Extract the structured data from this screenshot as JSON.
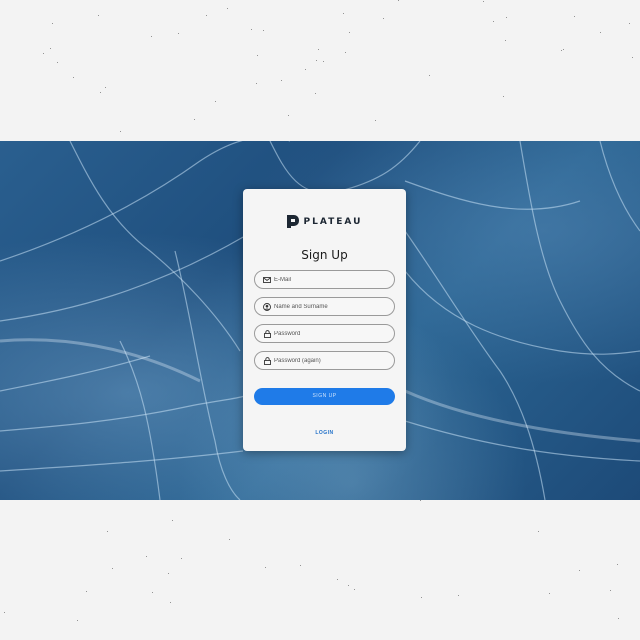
{
  "brand": {
    "name": "PLATEAU",
    "icon": "plateau-logo-icon",
    "color": "#1d2733"
  },
  "form": {
    "title": "Sign Up",
    "fields": [
      {
        "name": "email",
        "icon": "mail-icon",
        "placeholder": "E-Mail",
        "value": ""
      },
      {
        "name": "name",
        "icon": "user-circle-icon",
        "placeholder": "Name and Surname",
        "value": ""
      },
      {
        "name": "password",
        "icon": "lock-icon",
        "placeholder": "Password",
        "value": ""
      },
      {
        "name": "password-again",
        "icon": "lock-icon",
        "placeholder": "Password (again)",
        "value": ""
      }
    ],
    "submit_label": "SIGN UP",
    "login_link": "LOGIN"
  },
  "colors": {
    "accent": "#1f7be8",
    "background_band": "#24598a",
    "page_background": "#f3f3f3",
    "card_background": "#f5f5f5"
  }
}
